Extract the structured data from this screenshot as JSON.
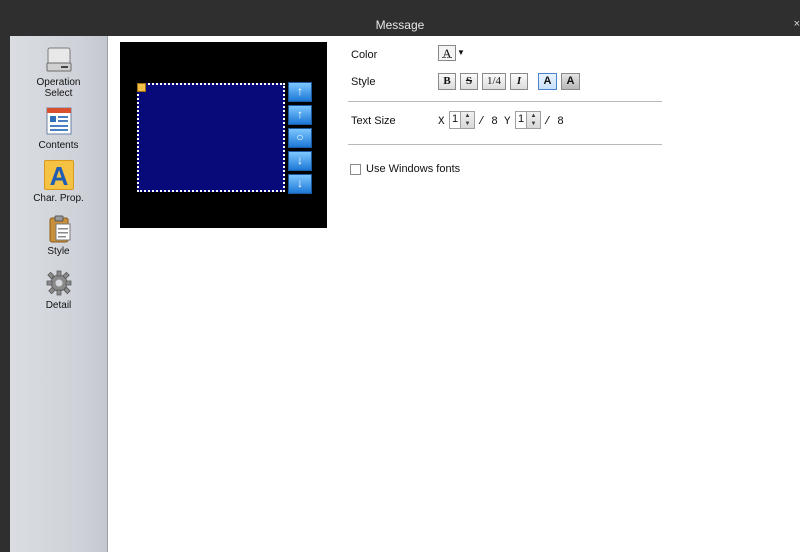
{
  "window": {
    "title": "Message",
    "close_glyph": "×"
  },
  "sidebar": {
    "items": [
      {
        "label_line1": "Operation",
        "label_line2": "Select",
        "icon": "drive-icon",
        "active": false
      },
      {
        "label": "Contents",
        "icon": "contents-icon",
        "active": false
      },
      {
        "label": "Char. Prop.",
        "icon": "letter-a-icon",
        "active": true
      },
      {
        "label": "Style",
        "icon": "clipboard-icon",
        "active": false
      },
      {
        "label": "Detail",
        "icon": "gear-icon",
        "active": false
      }
    ]
  },
  "properties": {
    "color_label": "Color",
    "color_swatch": "A",
    "style_label": "Style",
    "style_buttons": [
      "B",
      "S",
      "1/4",
      "I",
      "A",
      "A"
    ],
    "text_size_label": "Text Size",
    "x_label": "X",
    "x_value": "1",
    "x_denom": "/ 8",
    "y_label": "Y",
    "y_value": "1",
    "y_denom": "/ 8",
    "use_windows_fonts_label": "Use Windows fonts",
    "use_windows_fonts_checked": false
  },
  "preview": {
    "screen_color": "#080a7a",
    "scroll_buttons": [
      {
        "icon": "arrow-top-icon",
        "glyph": "↑"
      },
      {
        "icon": "arrow-up-icon",
        "glyph": "↑"
      },
      {
        "icon": "circle-icon",
        "glyph": "○"
      },
      {
        "icon": "arrow-down-icon",
        "glyph": "↓"
      },
      {
        "icon": "page-down-icon",
        "glyph": "↓"
      }
    ]
  }
}
